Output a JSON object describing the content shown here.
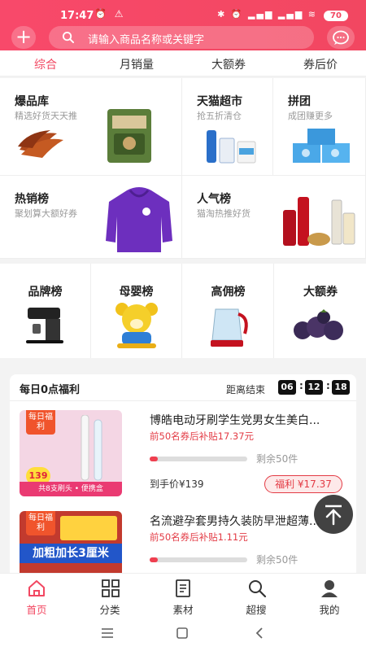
{
  "status": {
    "time": "17:47",
    "battery": "70"
  },
  "search": {
    "placeholder": "请输入商品名称或关键字"
  },
  "sort_tabs": [
    {
      "label": "综合",
      "active": true
    },
    {
      "label": "月销量",
      "active": false
    },
    {
      "label": "大额券",
      "active": false
    },
    {
      "label": "券后价",
      "active": false
    }
  ],
  "categories": [
    {
      "title": "爆品库",
      "subtitle": "精选好货天天推"
    },
    {
      "title": "天猫超市",
      "subtitle": "抢五折清仓"
    },
    {
      "title": "拼团",
      "subtitle": "成团赚更多"
    },
    {
      "title": "热销榜",
      "subtitle": "聚划算大额好券"
    },
    {
      "title": "人气榜",
      "subtitle": "猫淘热推好货"
    }
  ],
  "rankings": [
    {
      "title": "品牌榜"
    },
    {
      "title": "母婴榜"
    },
    {
      "title": "高佣榜"
    },
    {
      "title": "大额券"
    }
  ],
  "welfare": {
    "title": "每日0点福利",
    "countdown_label": "距离结束",
    "countdown": [
      "06",
      "12",
      "18"
    ],
    "products": [
      {
        "name": "博皓电动牙刷学生党男女生美白...",
        "subsidy": "前50名券后补贴17.37元",
        "remain": "剩余50件",
        "price": "到手价¥139",
        "welfare_button": "福利 ¥17.37",
        "progress": 0.08,
        "badge": "每日福利",
        "img_price": "139",
        "img_caption": "共8支刷头 • 便携盒"
      },
      {
        "name": "名流避孕套男持久装防早泄超薄...",
        "subsidy": "前50名券后补贴1.11元",
        "remain": "剩余50件",
        "progress": 0.08,
        "badge": "每日福利",
        "img_caption": "加粗加长3厘米"
      }
    ]
  },
  "tabbar": [
    {
      "label": "首页",
      "active": true,
      "icon": "home-icon"
    },
    {
      "label": "分类",
      "active": false,
      "icon": "grid-icon"
    },
    {
      "label": "素材",
      "active": false,
      "icon": "notes-icon"
    },
    {
      "label": "超搜",
      "active": false,
      "icon": "search-icon"
    },
    {
      "label": "我的",
      "active": false,
      "icon": "user-icon"
    }
  ],
  "colors": {
    "brand": "#f24761",
    "accent_red": "#e33b45"
  }
}
